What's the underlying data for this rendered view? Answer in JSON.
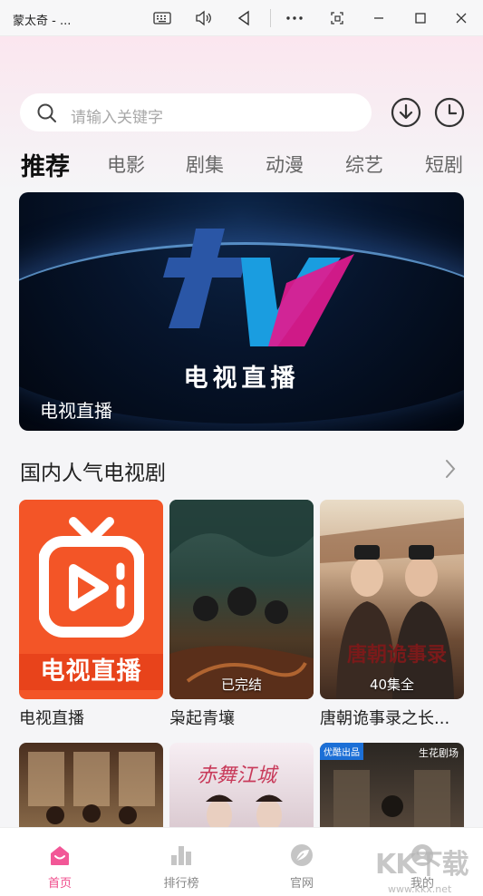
{
  "window": {
    "title": "蒙太奇 - ...",
    "controls": [
      "keyboard-icon",
      "volume-icon",
      "back-icon",
      "more-icon",
      "restore-icon",
      "minimize-icon",
      "maximize-icon",
      "close-icon"
    ]
  },
  "search": {
    "placeholder": "请输入关键字"
  },
  "header_icons": [
    "download-icon",
    "history-icon"
  ],
  "tabs": [
    {
      "label": "推荐",
      "active": true
    },
    {
      "label": "电影"
    },
    {
      "label": "剧集"
    },
    {
      "label": "动漫"
    },
    {
      "label": "综艺"
    },
    {
      "label": "短剧"
    }
  ],
  "banner": {
    "caption": "电视直播",
    "logo_text": "电视直播"
  },
  "section": {
    "title": "国内人气电视剧"
  },
  "cards": [
    {
      "label": "电视直播",
      "poster_text": "电视直播",
      "badge": ""
    },
    {
      "label": "枭起青壤",
      "badge": "已完结"
    },
    {
      "label": "唐朝诡事录之长...",
      "badge": "40集全"
    }
  ],
  "cards_row2": [
    {
      "poster_text": ""
    },
    {
      "poster_text": "赤舞江城"
    },
    {
      "tag": "优酷出品",
      "brand": "生花剧场"
    }
  ],
  "bottom_nav": [
    {
      "label": "首页",
      "icon": "home-icon",
      "active": true
    },
    {
      "label": "排行榜",
      "icon": "rank-icon"
    },
    {
      "label": "官网",
      "icon": "leaf-icon"
    },
    {
      "label": "我的",
      "icon": "user-icon"
    }
  ],
  "watermark": {
    "text": "KK下载",
    "url": "www.kkx.net"
  },
  "colors": {
    "accent": "#f04a8a",
    "tv_orange": "#f35527"
  }
}
